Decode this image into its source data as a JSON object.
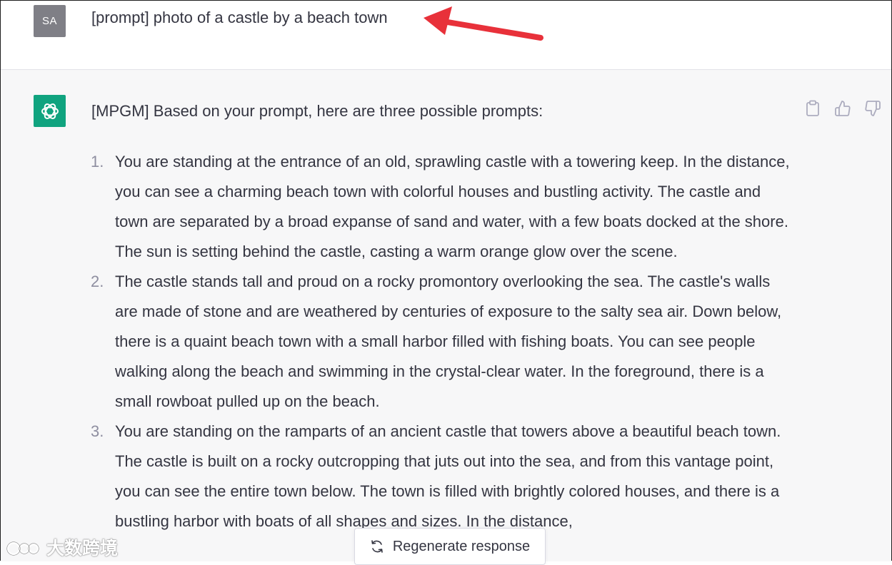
{
  "user_message": {
    "avatar_initials": "SA",
    "text": "[prompt] photo of a castle by a beach town"
  },
  "assistant_message": {
    "avatar_icon": "openai-logo-icon",
    "intro": "[MPGM] Based on your prompt, here are three possible prompts:",
    "items": [
      {
        "number": "1.",
        "text": "You are standing at the entrance of an old, sprawling castle with a towering keep. In the distance, you can see a charming beach town with colorful houses and bustling activity. The castle and town are separated by a broad expanse of sand and water, with a few boats docked at the shore. The sun is setting behind the castle, casting a warm orange glow over the scene."
      },
      {
        "number": "2.",
        "text": "The castle stands tall and proud on a rocky promontory overlooking the sea. The castle's walls are made of stone and are weathered by centuries of exposure to the salty sea air. Down below, there is a quaint beach town with a small harbor filled with fishing boats. You can see people walking along the beach and swimming in the crystal-clear water. In the foreground, there is a small rowboat pulled up on the beach."
      },
      {
        "number": "3.",
        "text": "You are standing on the ramparts of an ancient castle that towers above a beautiful beach town. The castle is built on a rocky outcropping that juts out into the sea, and from this vantage point, you can see the entire town below. The town is filled with brightly colored houses, and there is a bustling harbor with boats of all shapes and sizes. In the distance,"
      }
    ]
  },
  "actions": {
    "copy_icon": "clipboard-icon",
    "like_icon": "thumbs-up-icon",
    "dislike_icon": "thumbs-down-icon"
  },
  "regenerate": {
    "label": "Regenerate response",
    "icon": "refresh-icon"
  },
  "watermark": {
    "text": "大数跨境"
  },
  "colors": {
    "accent": "#10a37f",
    "annotation_arrow": "#e8313a",
    "assistant_bg": "#f7f7f8",
    "user_avatar_bg": "#7f7f86"
  }
}
